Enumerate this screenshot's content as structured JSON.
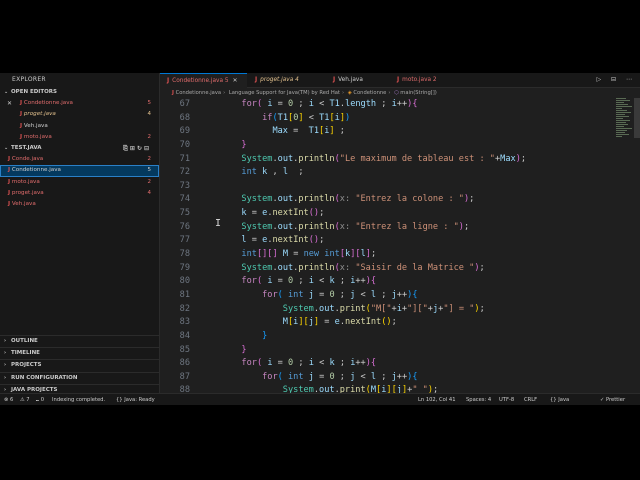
{
  "sidebar": {
    "header": "EXPLORER",
    "open_editors_label": "OPEN EDITORS",
    "open_editors": [
      {
        "x": "✕",
        "name": "Condetionne.java",
        "count": "5",
        "name_color": "red",
        "count_color": "red"
      },
      {
        "x": "",
        "name": "proget.java",
        "count": "4",
        "name_color": "yellow",
        "count_color": "yellow"
      },
      {
        "x": "",
        "name": "Veh.java",
        "count": "",
        "name_color": "white",
        "count_color": "white"
      },
      {
        "x": "",
        "name": "moto.java",
        "count": "2",
        "name_color": "red",
        "count_color": "red"
      }
    ],
    "project_label": "TEST.JAVA",
    "project_files": [
      {
        "name": "Conde.java",
        "count": "2",
        "color": "red"
      },
      {
        "name": "Condetionne.java",
        "count": "5",
        "color": "red"
      },
      {
        "name": "moto.java",
        "count": "2",
        "color": "red"
      },
      {
        "name": "proget.java",
        "count": "4",
        "color": "red"
      },
      {
        "name": "Veh.java",
        "count": "",
        "color": "red"
      }
    ],
    "bottom_sections": [
      "OUTLINE",
      "TIMELINE",
      "PROJECTS",
      "RUN CONFIGURATION",
      "JAVA PROJECTS"
    ]
  },
  "tabs": [
    {
      "label": "Condetionne.java 5",
      "close": "✕",
      "active": true
    },
    {
      "label": "proget.java 4",
      "close": "",
      "active": false
    },
    {
      "label": "Veh.java",
      "close": "",
      "active": false
    },
    {
      "label": "moto.java 2",
      "close": "",
      "active": false
    }
  ],
  "tab_actions": "▷ ⊟ ⋯",
  "breadcrumb": {
    "file": "Condetionne.java",
    "project": "Language Support for Java(TM) by Red Hat",
    "class": "Condetionne",
    "method": "main(String[])"
  },
  "editor": {
    "line_numbers": [
      "67",
      "68",
      "69",
      "70",
      "71",
      "72",
      "73",
      "74",
      "75",
      "76",
      "77",
      "78",
      "79",
      "80",
      "81",
      "82",
      "83",
      "84",
      "85",
      "86",
      "87",
      "88"
    ]
  },
  "status": {
    "errors": "⊗ 6",
    "warnings": "⚠ 7",
    "ports": "⑉ 0",
    "indexing": "Indexing completed.",
    "java_ready": "{} Java: Ready",
    "position": "Ln 102, Col 41",
    "spaces": "Spaces: 4",
    "encoding": "UTF-8",
    "eol": "CRLF",
    "language": "{} Java",
    "prettier": "✓ Prettier"
  }
}
